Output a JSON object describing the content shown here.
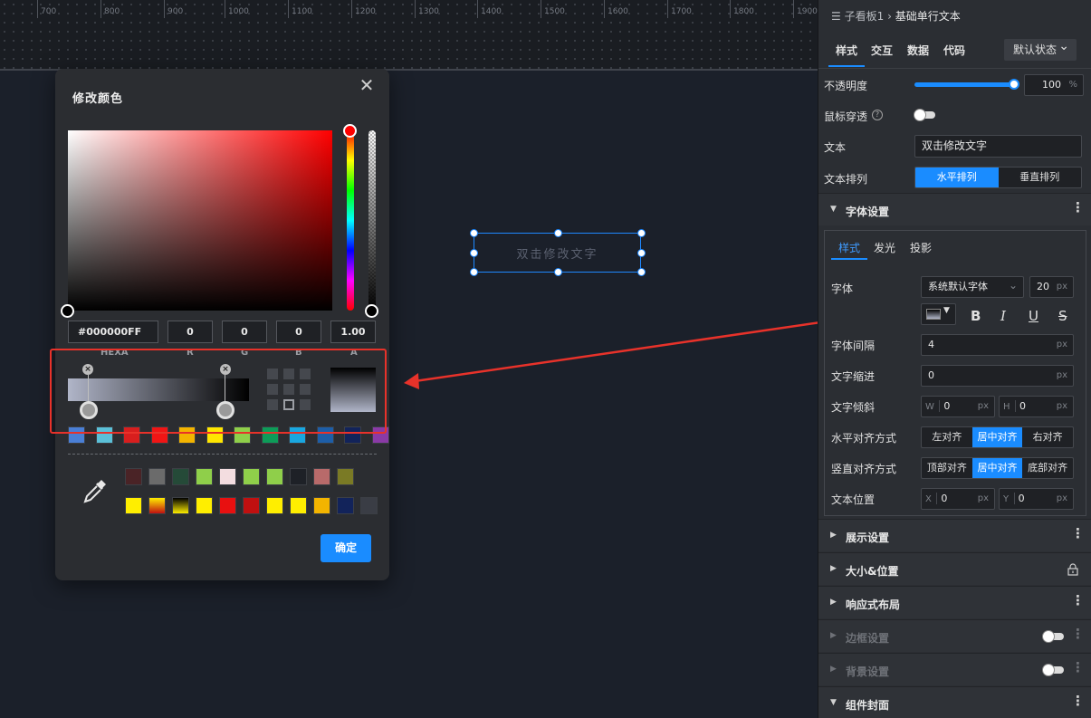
{
  "ruler": {
    "ticks": [
      "700",
      "800",
      "900",
      "1000",
      "1100",
      "1200",
      "1300",
      "1400",
      "1500",
      "1600",
      "1700",
      "1800",
      "1900"
    ]
  },
  "canvas": {
    "component_text": "双击修改文字"
  },
  "picker": {
    "title": "修改颜色",
    "close_glyph": "✕",
    "hex_value": "#000000FF",
    "r": "0",
    "g": "0",
    "b": "0",
    "a": "1.00",
    "labels": {
      "hex": "HEXA",
      "r": "R",
      "g": "G",
      "b": "B",
      "a": "A"
    },
    "stop_remove_glyph": "×",
    "ok_label": "确定",
    "swatch_row1": [
      "#4a7fd6",
      "#5bc0d8",
      "#d81e1e",
      "#f01515",
      "#f3b400",
      "#ffe600",
      "#8fcf4a",
      "#0d9c58",
      "#19a7e0",
      "#1d5ea8",
      "#12235a",
      "#8a3aa6"
    ],
    "swatch_row2": [
      "#4a2326",
      "#6b6b6b",
      "#254a38",
      "#8fcf4a",
      "#f3dde0",
      "#8fcf4a",
      "#8fcf4a",
      "#1e2127",
      "#b86a6a",
      "#7a7a25"
    ],
    "swatch_row3": [
      "#ffee00",
      "grad-yellow-red",
      "grad-black-yellow",
      "#ffee00",
      "#e81010",
      "#c01010",
      "#ffee00",
      "#ffee00",
      "#f3b400",
      "#12235a",
      "#3a3d45"
    ],
    "colors": {
      "accent": "#1a8cff",
      "annotation": "#e8322a"
    },
    "icons": {
      "eyedropper": "eyedropper-icon"
    }
  },
  "panel": {
    "breadcrumb": {
      "icon": "☰",
      "parent": "子看板1",
      "separator": "›",
      "current": "基础单行文本"
    },
    "tabs": [
      "样式",
      "交互",
      "数据",
      "代码"
    ],
    "state_select": "默认状态",
    "opacity": {
      "label": "不透明度",
      "value": "100",
      "unit": "%",
      "fraction": 1.0
    },
    "mouse_through": {
      "label": "鼠标穿透",
      "help_glyph": "?"
    },
    "text": {
      "label": "文本",
      "value": "双击修改文字"
    },
    "text_layout": {
      "label": "文本排列",
      "options": [
        "水平排列",
        "垂直排列"
      ],
      "selected": 0
    },
    "font_section": {
      "title": "字体设置",
      "tabs": [
        "样式",
        "发光",
        "投影"
      ],
      "font": {
        "label": "字体",
        "value": "系统默认字体",
        "size": "20",
        "unit": "px"
      },
      "style_buttons": [
        "B",
        "I",
        "U",
        "S"
      ],
      "letter_spacing": {
        "label": "字体间隔",
        "value": "4",
        "unit": "px"
      },
      "indent": {
        "label": "文字缩进",
        "value": "0",
        "unit": "px"
      },
      "skew": {
        "label": "文字倾斜",
        "w_label": "W",
        "w_value": "0",
        "h_label": "H",
        "h_value": "0",
        "unit": "px"
      },
      "h_align": {
        "label": "水平对齐方式",
        "options": [
          "左对齐",
          "居中对齐",
          "右对齐"
        ],
        "selected": 1
      },
      "v_align": {
        "label": "竖直对齐方式",
        "options": [
          "顶部对齐",
          "居中对齐",
          "底部对齐"
        ],
        "selected": 1
      },
      "position": {
        "label": "文本位置",
        "x_label": "X",
        "x_value": "0",
        "y_label": "Y",
        "y_value": "0",
        "unit": "px"
      }
    },
    "sections": [
      {
        "title": "展示设置",
        "tail": "more"
      },
      {
        "title": "大小&位置",
        "tail": "lock"
      },
      {
        "title": "响应式布局",
        "tail": "more"
      },
      {
        "title": "边框设置",
        "tail": "toggle",
        "dim": true
      },
      {
        "title": "背景设置",
        "tail": "toggle",
        "dim": true
      },
      {
        "title": "组件封面",
        "tail": "more",
        "expanded": true
      }
    ],
    "glyphs": {
      "caret_right": "▶",
      "caret_down": "▼",
      "more": "⋮",
      "chevron": "⌄"
    }
  }
}
